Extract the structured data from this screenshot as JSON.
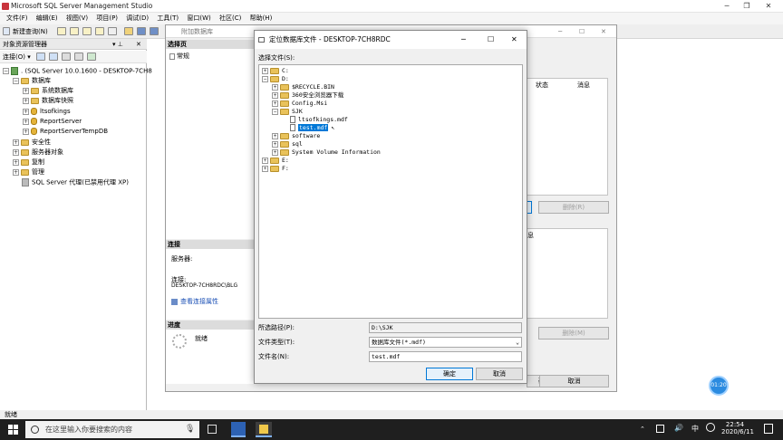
{
  "ssms": {
    "title": "Microsoft SQL Server Management Studio",
    "menu": [
      "文件(F)",
      "编辑(E)",
      "视图(V)",
      "项目(P)",
      "调试(D)",
      "工具(T)",
      "窗口(W)",
      "社区(C)",
      "帮助(H)"
    ],
    "toolbar": {
      "new_query": "新建查询(N)"
    },
    "status": "就绪"
  },
  "object_explorer": {
    "title": "对象资源管理器",
    "connect": "连接(O) ▾",
    "server": ". (SQL Server 10.0.1600 - DESKTOP-7CH8",
    "databases": "数据库",
    "system_dbs": "系统数据库",
    "snapshots": "数据库快照",
    "db1": "ltsofkings",
    "db2": "ReportServer",
    "db3": "ReportServerTempDB",
    "security": "安全性",
    "server_objects": "服务器对象",
    "replication": "复制",
    "management": "管理",
    "agent": "SQL Server 代理(已禁用代理 XP)"
  },
  "attach_dialog": {
    "title": "附加数据库",
    "select_page": "选择页",
    "general": "常规",
    "connection": "连接",
    "server_label": "服务器:",
    "conn_label": "连接:",
    "conn_value": "DESKTOP-7CH8RDC\\BLG",
    "view_props": "查看连接属性",
    "progress": "进度",
    "ready": "就绪",
    "col_status": "状态",
    "col_message": "消息",
    "remove": "删除(R)",
    "info": "息",
    "remove2": "删除(M)",
    "ok": "确定",
    "cancel": "取消"
  },
  "locate_dialog": {
    "title": "定位数据库文件 - DESKTOP-7CH8RDC",
    "select_file": "选择文件(S):",
    "tree": {
      "c": "C:",
      "d": "D:",
      "recycle": "$RECYCLE.BIN",
      "browser": "360安全浏览器下载",
      "config": "Config.Msi",
      "sjk": "SJK",
      "ltsofkings_mdf": "ltsofkings.mdf",
      "test_mdf": "test.mdf",
      "software": "software",
      "sql": "sql",
      "svi": "System Volume Information",
      "e": "E:",
      "f": "F:"
    },
    "path_label": "所选路径(P):",
    "path_value": "D:\\SJK",
    "type_label": "文件类型(T):",
    "type_value": "数据库文件(*.mdf)",
    "name_label": "文件名(N):",
    "name_value": "test.mdf",
    "ok": "确定",
    "cancel": "取消"
  },
  "taskbar": {
    "search_placeholder": "在这里输入你要搜索的内容",
    "time": "22:54",
    "date": "2020/6/11",
    "ime": "中",
    "timer_badge": "01:20"
  }
}
